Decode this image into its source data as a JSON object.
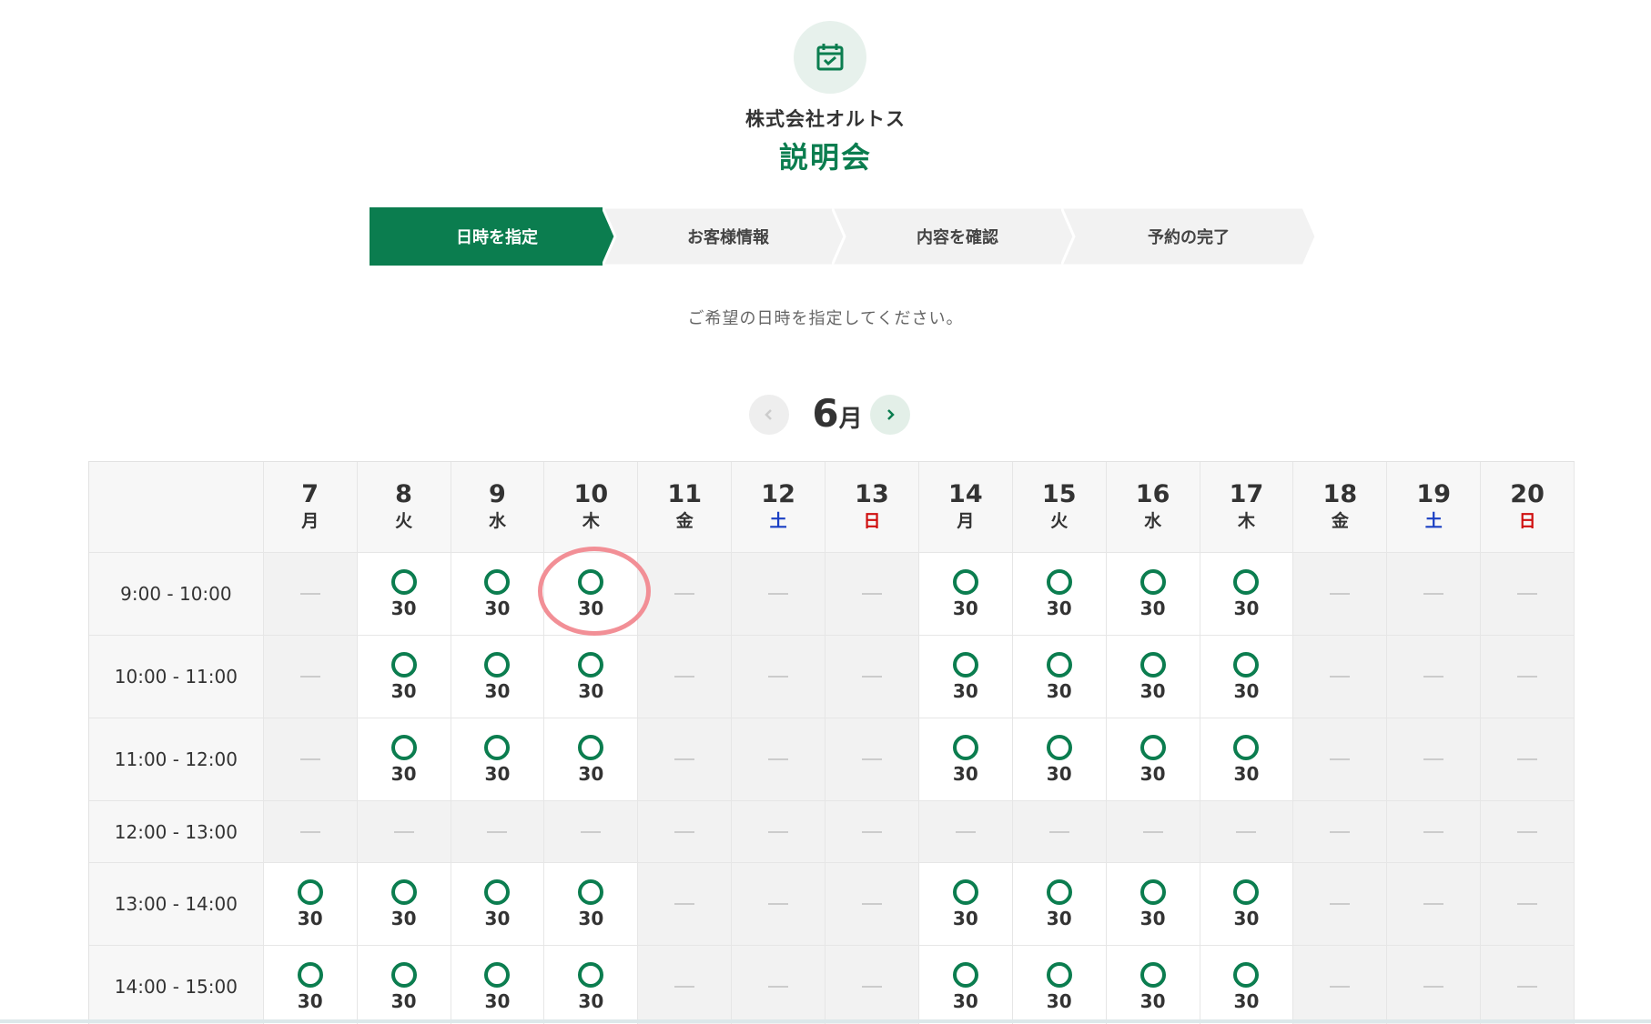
{
  "header": {
    "icon": "calendar-check-icon",
    "company": "株式会社オルトス",
    "title": "説明会"
  },
  "colors": {
    "accent": "#0b7d4f",
    "saturday": "#1a3fc4",
    "sunday": "#d01010",
    "highlight": "#f28f96"
  },
  "steps": [
    {
      "label": "日時を指定",
      "active": true
    },
    {
      "label": "お客様情報",
      "active": false
    },
    {
      "label": "内容を確認",
      "active": false
    },
    {
      "label": "予約の完了",
      "active": false
    }
  ],
  "instruction": "ご希望の日時を指定してください。",
  "month_nav": {
    "month": "6",
    "suffix": "月",
    "prev_icon": "chevron-left-icon",
    "next_icon": "chevron-right-icon"
  },
  "calendar": {
    "days": [
      {
        "num": "7",
        "wday": "月",
        "kind": "weekday"
      },
      {
        "num": "8",
        "wday": "火",
        "kind": "weekday"
      },
      {
        "num": "9",
        "wday": "水",
        "kind": "weekday"
      },
      {
        "num": "10",
        "wday": "木",
        "kind": "weekday"
      },
      {
        "num": "11",
        "wday": "金",
        "kind": "weekday"
      },
      {
        "num": "12",
        "wday": "土",
        "kind": "sat"
      },
      {
        "num": "13",
        "wday": "日",
        "kind": "sun"
      },
      {
        "num": "14",
        "wday": "月",
        "kind": "weekday"
      },
      {
        "num": "15",
        "wday": "火",
        "kind": "weekday"
      },
      {
        "num": "16",
        "wday": "水",
        "kind": "weekday"
      },
      {
        "num": "17",
        "wday": "木",
        "kind": "weekday"
      },
      {
        "num": "18",
        "wday": "金",
        "kind": "weekday"
      },
      {
        "num": "19",
        "wday": "土",
        "kind": "sat"
      },
      {
        "num": "20",
        "wday": "日",
        "kind": "sun"
      }
    ],
    "rows": [
      {
        "time": "9:00 - 10:00",
        "slots": [
          "-",
          "30",
          "30",
          "30",
          "-",
          "-",
          "-",
          "30",
          "30",
          "30",
          "30",
          "-",
          "-",
          "-"
        ]
      },
      {
        "time": "10:00 - 11:00",
        "slots": [
          "-",
          "30",
          "30",
          "30",
          "-",
          "-",
          "-",
          "30",
          "30",
          "30",
          "30",
          "-",
          "-",
          "-"
        ]
      },
      {
        "time": "11:00 - 12:00",
        "slots": [
          "-",
          "30",
          "30",
          "30",
          "-",
          "-",
          "-",
          "30",
          "30",
          "30",
          "30",
          "-",
          "-",
          "-"
        ]
      },
      {
        "time": "12:00 - 13:00",
        "slots": [
          "-",
          "-",
          "-",
          "-",
          "-",
          "-",
          "-",
          "-",
          "-",
          "-",
          "-",
          "-",
          "-",
          "-"
        ]
      },
      {
        "time": "13:00 - 14:00",
        "slots": [
          "30",
          "30",
          "30",
          "30",
          "-",
          "-",
          "-",
          "30",
          "30",
          "30",
          "30",
          "-",
          "-",
          "-"
        ]
      },
      {
        "time": "14:00 - 15:00",
        "slots": [
          "30",
          "30",
          "30",
          "30",
          "-",
          "-",
          "-",
          "30",
          "30",
          "30",
          "30",
          "-",
          "-",
          "-"
        ]
      }
    ]
  }
}
